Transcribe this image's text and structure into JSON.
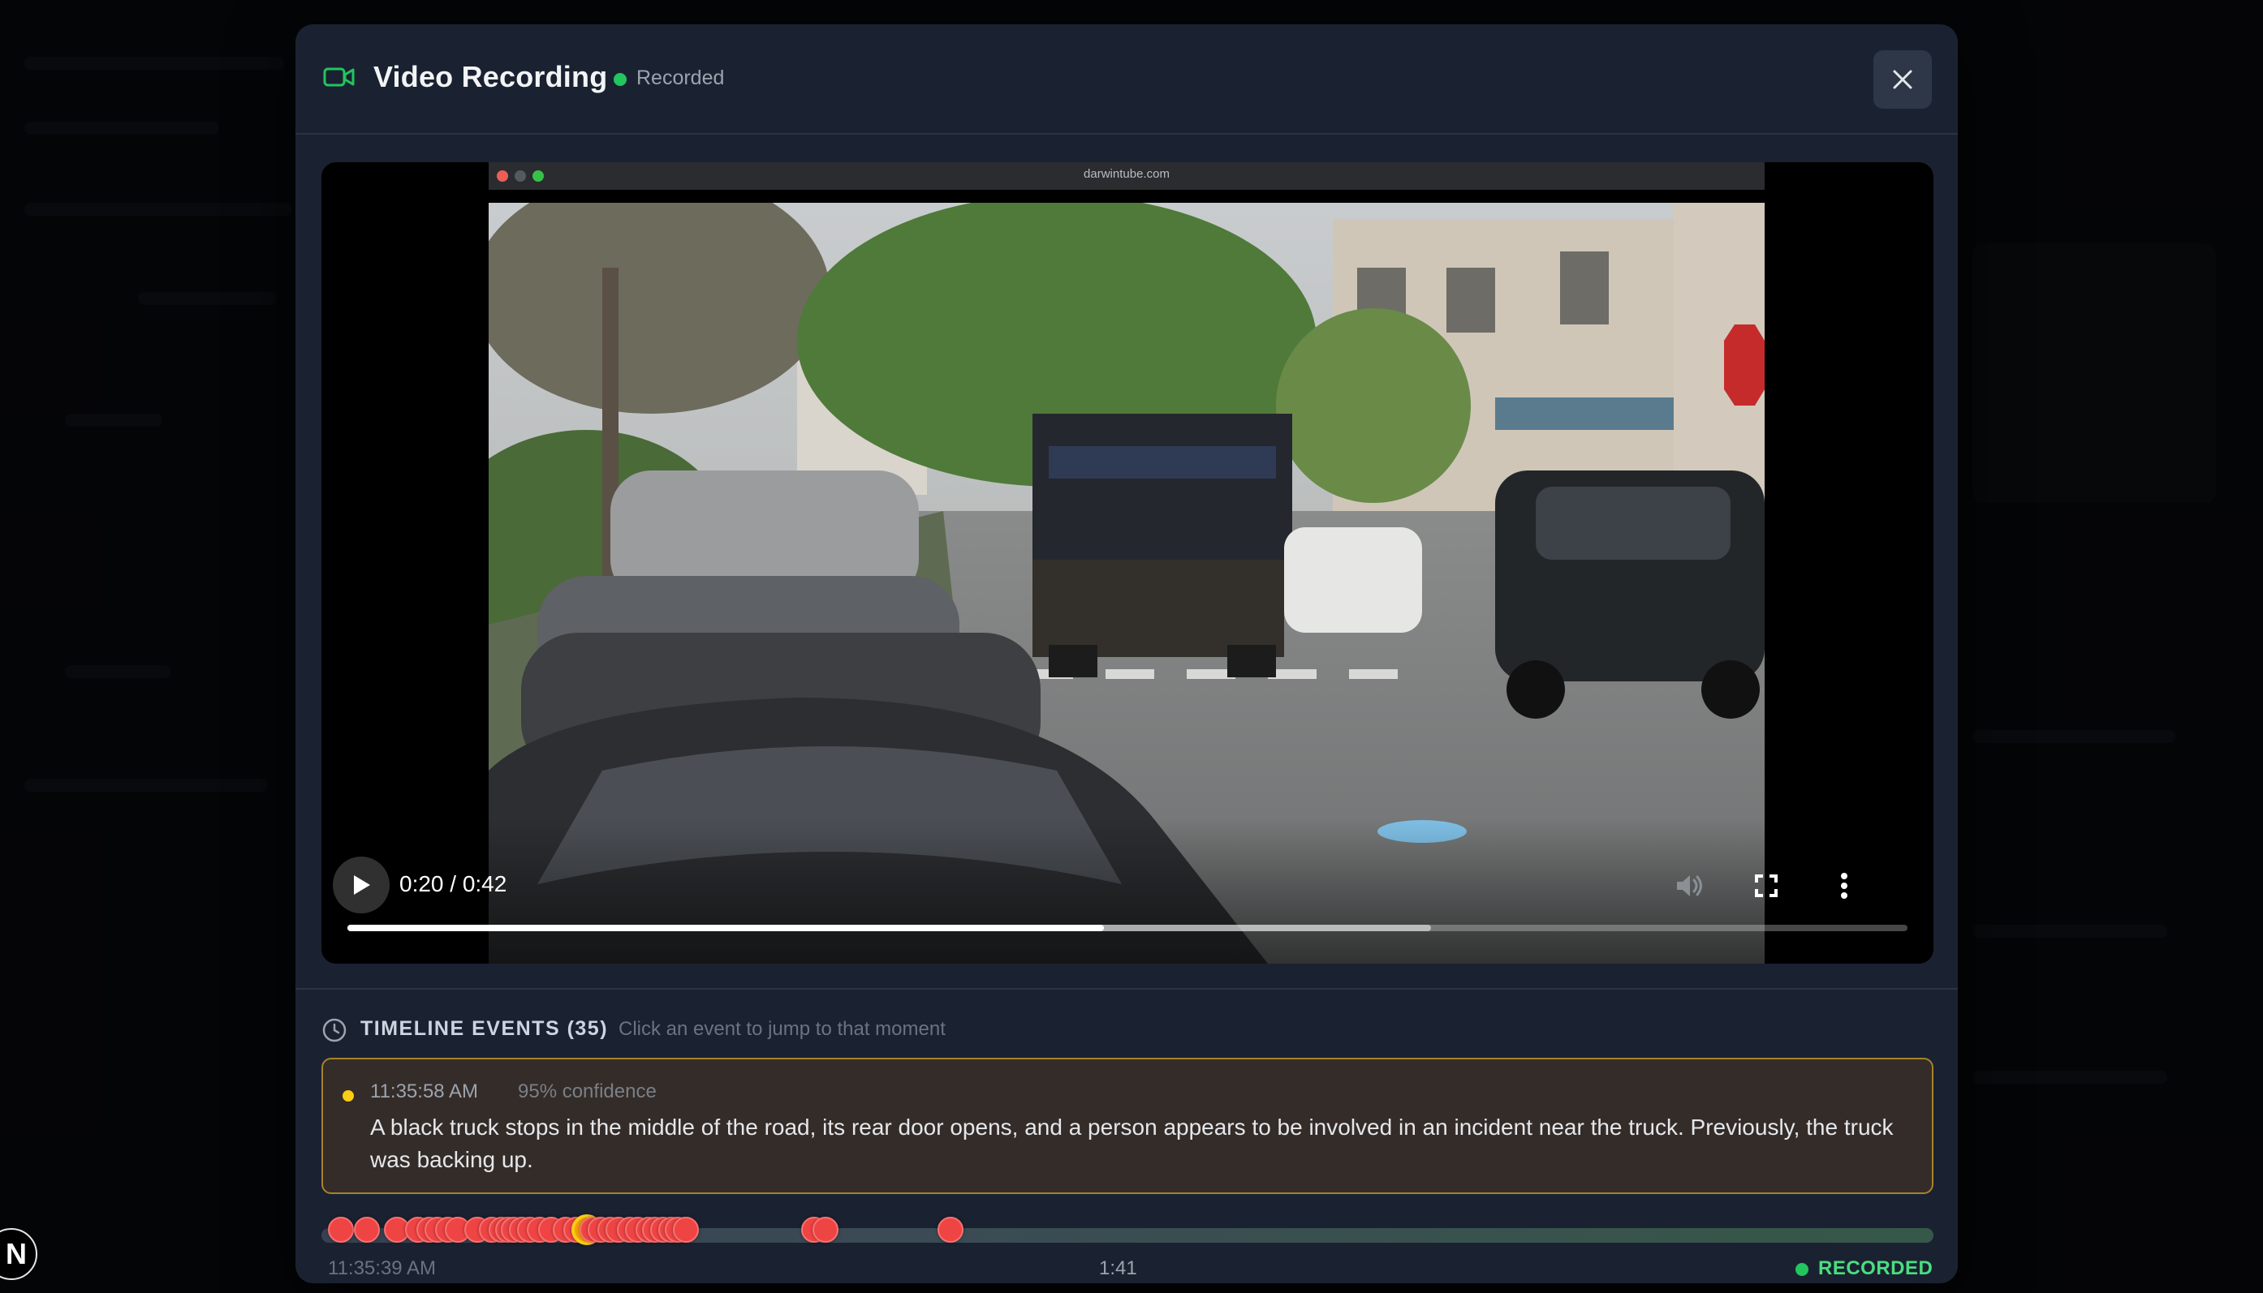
{
  "modal": {
    "title": "Video Recording",
    "status": "Recorded",
    "close_label": "Close"
  },
  "video": {
    "url": "darwintube.com",
    "time": "0:20 / 0:42",
    "progress": 0.4847,
    "buffered": 0.6944
  },
  "timeline": {
    "title": "TIMELINE EVENTS (35)",
    "hint": "Click an event to jump to that moment",
    "selected_event": {
      "time": "11:35:58 AM",
      "confidence": "95% confidence",
      "description": "A black truck stops in the middle of the road, its rear door opens, and a person appears to be involved in an incident near the truck. Previously, the truck was backing up."
    },
    "start_label": "11:35:39 AM",
    "mid_label": "1:41",
    "end_status": "RECORDED",
    "markers": [
      0.0,
      0.016,
      0.035,
      0.048,
      0.055,
      0.06,
      0.067,
      0.073,
      0.085,
      0.094,
      0.1,
      0.104,
      0.108,
      0.113,
      0.118,
      0.124,
      0.131,
      0.14,
      0.147,
      0.152,
      0.157,
      0.162,
      0.168,
      0.173,
      0.18,
      0.185,
      0.192,
      0.196,
      0.201,
      0.206,
      0.21,
      0.215,
      0.295,
      0.302,
      0.38
    ],
    "active_marker": 19
  },
  "colors": {
    "accent_green": "#22c55e",
    "marker_red": "#ef4444",
    "active_yellow": "#facc15"
  }
}
